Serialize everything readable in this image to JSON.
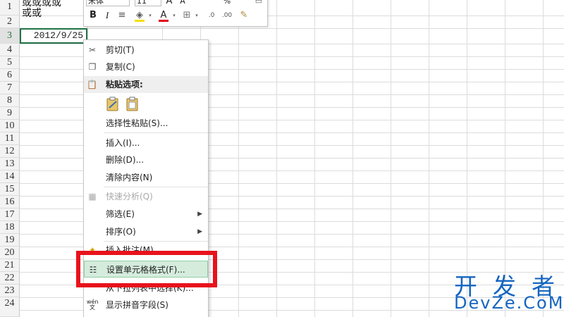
{
  "sheet": {
    "rows": [
      "1",
      "2",
      "3",
      "4",
      "5",
      "6",
      "7",
      "8",
      "9",
      "10",
      "11",
      "12",
      "13",
      "14",
      "15",
      "16",
      "17",
      "18",
      "19",
      "20",
      "21",
      "22",
      "23",
      "24"
    ],
    "cell_a1_line1": "或或或或",
    "cell_a1_line2": "或或",
    "cell_a3_value": "2012/9/25"
  },
  "mini_toolbar": {
    "font_name": "宋体",
    "font_size": "11",
    "grow_font": "A",
    "shrink_font": "A",
    "percent": "%",
    "bold": "B",
    "italic": "I",
    "align": "≡",
    "fill_color": "#f4e000",
    "font_color_label": "A",
    "font_color": "#e2001a"
  },
  "context_menu": {
    "cut": "剪切(T)",
    "copy": "复制(C)",
    "paste_options": "粘贴选项:",
    "paste_special": "选择性粘贴(S)...",
    "insert": "插入(I)...",
    "delete": "删除(D)...",
    "clear_contents": "清除内容(N)",
    "quick_analysis": "快速分析(Q)",
    "filter": "筛选(E)",
    "sort": "排序(O)",
    "insert_comment": "插入批注(M)",
    "format_cells": "设置单元格格式(F)...",
    "pick_from_list": "从下拉列表中选择(K)...",
    "phonetic": "显示拼音字段(S)"
  },
  "watermark": {
    "cn": "开发者",
    "en": "DevZe.CoM"
  },
  "colors": {
    "accent_green": "#217346",
    "highlight_red": "#e8121c",
    "watermark_blue": "#1565c0"
  }
}
